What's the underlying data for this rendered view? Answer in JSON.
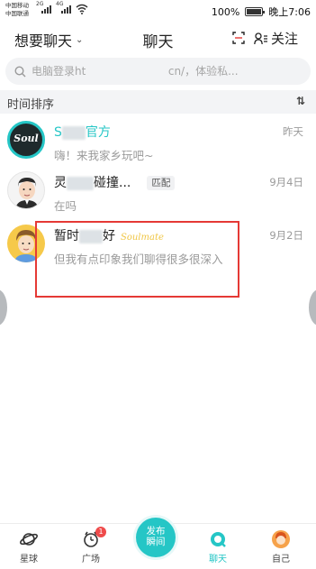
{
  "status_bar": {
    "carrier1": "中国移动",
    "carrier2": "中国联通",
    "net1": "2G",
    "net2": "4G",
    "battery": "100%",
    "time": "晚上7:06"
  },
  "header": {
    "left_title": "想要聊天",
    "center_title": "聊天",
    "follow_label": "关注"
  },
  "search": {
    "placeholder": "电脑登录ht                        cn/，体验私..."
  },
  "sort_bar": {
    "label": "时间排序",
    "icon": "sort-icon"
  },
  "chats": [
    {
      "name_prefix": "S",
      "name_suffix": "官方",
      "preview": "嗨！来我家乡玩吧~",
      "time": "昨天",
      "avatar_text": "Soul",
      "name_color": "#25c6c6"
    },
    {
      "name_prefix": "灵",
      "name_suffix": "碰撞...",
      "tag": "匹配",
      "preview": "在吗",
      "time": "9月4日"
    },
    {
      "name_prefix": "暂时",
      "name_suffix": "好",
      "badge": "Soulmate",
      "preview": "但我有点印象我们聊得很多很深入",
      "time": "9月2日"
    }
  ],
  "tabbar": {
    "tabs": [
      {
        "label": "星球",
        "icon": "planet-icon"
      },
      {
        "label": "广场",
        "icon": "square-icon",
        "badge": "1"
      },
      {
        "label": "聊天",
        "icon": "chat-icon",
        "active": true
      },
      {
        "label": "自己",
        "icon": "avatar-icon"
      }
    ],
    "publish_line1": "发布",
    "publish_line2": "瞬间"
  },
  "colors": {
    "accent": "#25c6c6",
    "annotation": "#e53935"
  }
}
